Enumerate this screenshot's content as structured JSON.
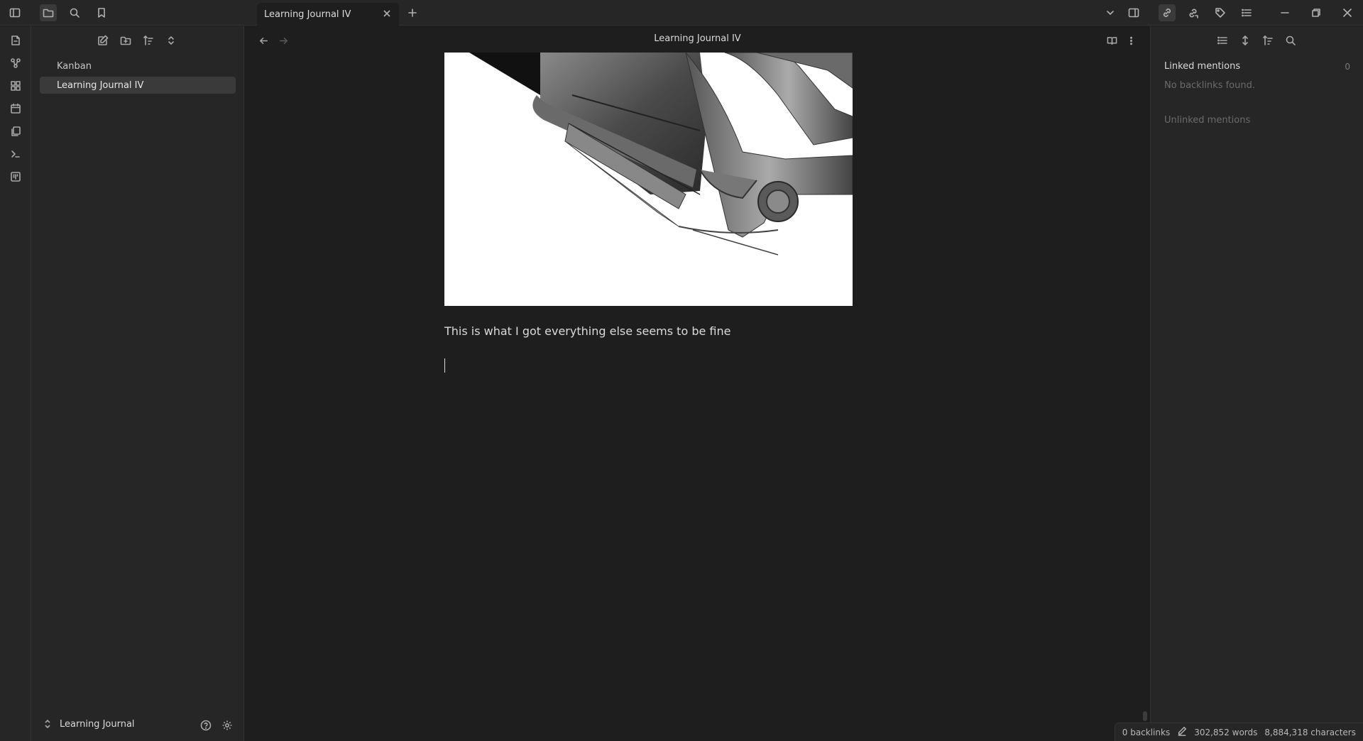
{
  "tab": {
    "title": "Learning Journal IV"
  },
  "explorer": {
    "files": [
      {
        "name": "Kanban"
      },
      {
        "name": "Learning Journal IV"
      }
    ],
    "vault_name": "Learning Journal"
  },
  "editor": {
    "title": "Learning Journal IV",
    "body_text": "This is what I got everything else seems to be fine"
  },
  "backlinks": {
    "linked_heading": "Linked mentions",
    "linked_count": "0",
    "empty_text": "No backlinks found.",
    "unlinked_heading": "Unlinked mentions"
  },
  "status": {
    "backlinks": "0 backlinks",
    "words": "302,852 words",
    "characters": "8,884,318 characters"
  },
  "colors": {
    "background": "#1e1e1e",
    "panel": "#262626",
    "active_item": "#3a3a3a"
  }
}
